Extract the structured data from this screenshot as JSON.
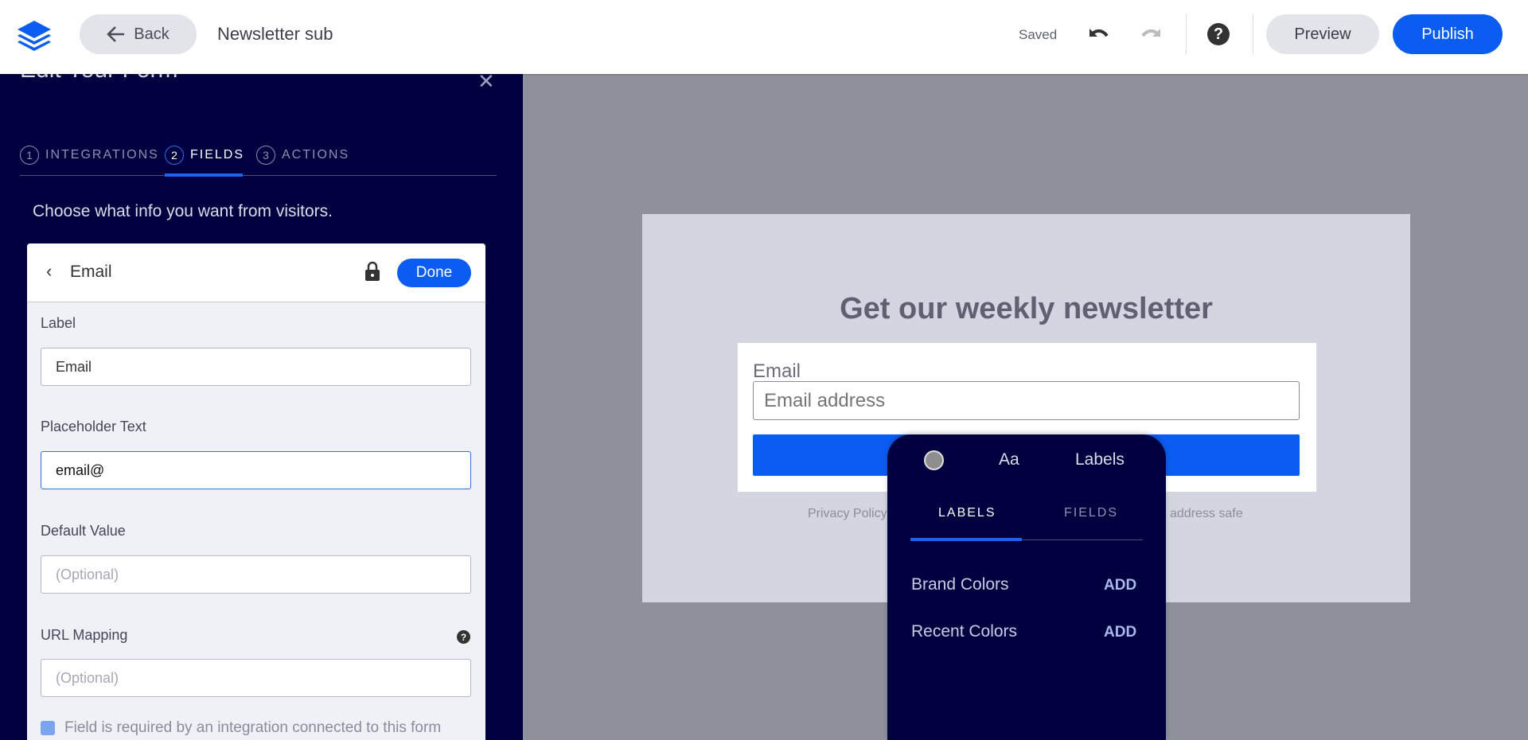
{
  "topbar": {
    "back": "Back",
    "title": "Newsletter sub",
    "status": "Saved",
    "preview": "Preview",
    "publish": "Publish"
  },
  "panel": {
    "title": "Edit Your Form",
    "tabs": [
      {
        "num": "1",
        "label": "INTEGRATIONS"
      },
      {
        "num": "2",
        "label": "FIELDS"
      },
      {
        "num": "3",
        "label": "ACTIONS"
      }
    ],
    "intro": "Choose what info you want from visitors.",
    "card": {
      "field": "Email",
      "done": "Done",
      "label_label": "Label",
      "label_value": "Email",
      "placeholder_label": "Placeholder Text",
      "placeholder_value": "email@",
      "default_label": "Default Value",
      "default_placeholder": "(Optional)",
      "url_label": "URL Mapping",
      "url_placeholder": "(Optional)",
      "required_text": "Field is required by an integration connected to this form"
    }
  },
  "preview": {
    "heading": "Get our weekly newsletter",
    "email_label": "Email",
    "email_placeholder": "Email address",
    "privacy": "Privacy Policy",
    "safe": "address safe"
  },
  "popup": {
    "aa": "Aa",
    "labels": "Labels",
    "tabs": [
      "LABELS",
      "FIELDS"
    ],
    "rows": [
      {
        "label": "Brand Colors",
        "action": "ADD"
      },
      {
        "label": "Recent Colors",
        "action": "ADD"
      }
    ],
    "swatch_color": "#8e8e8e"
  },
  "colors": {
    "accent": "#0b5cf0",
    "panel": "#01013f"
  }
}
